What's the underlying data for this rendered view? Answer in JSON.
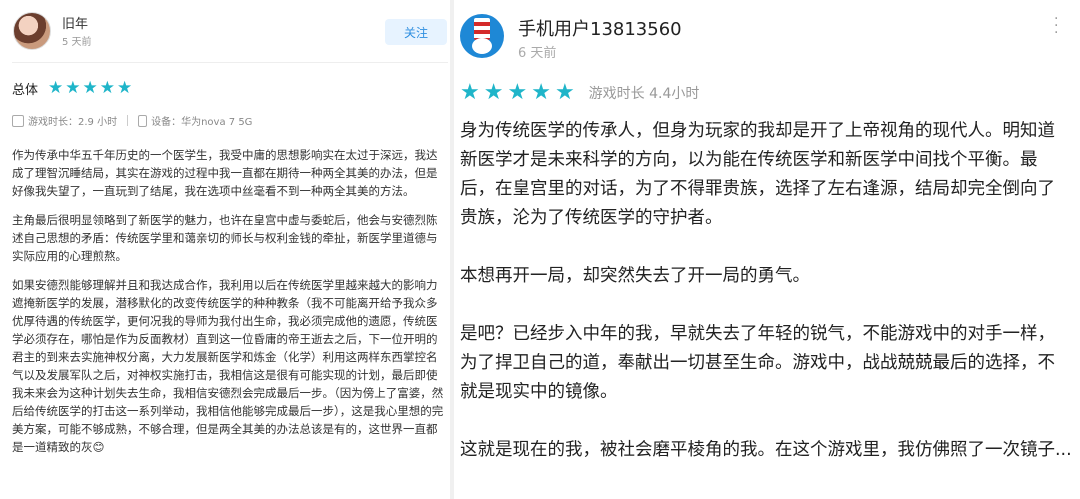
{
  "left": {
    "user_name": "旧年",
    "time": "5 天前",
    "follow_label": "关注",
    "rating_label": "总体",
    "stars": 5,
    "playtime_label": "游戏时长：2.9 小时",
    "device_label": "设备：华为nova 7 5G",
    "paragraphs": [
      "作为传承中华五千年历史的一个医学生，我受中庸的思想影响实在太过于深远，我达成了理智沉睡结局，其实在游戏的过程中我一直都在期待一种两全其美的办法，但是好像我失望了，一直玩到了结尾，我在选项中丝毫看不到一种两全其美的方法。",
      "主角最后很明显领略到了新医学的魅力，也许在皇宫中虚与委蛇后，他会与安德烈陈述自己思想的矛盾：传统医学里和蔼亲切的师长与权利金钱的牵扯，新医学里道德与实际应用的心理煎熬。",
      "如果安德烈能够理解并且和我达成合作，我利用以后在传统医学里越来越大的影响力遮掩新医学的发展，潜移默化的改变传统医学的种种教条（我不可能离开给予我众多优厚待遇的传统医学，更何况我的导师为我付出生命，我必须完成他的遗愿，传统医学必须存在，哪怕是作为反面教材）直到这一位昏庸的帝王逝去之后，下一位开明的君主的到来去实施神权分离，大力发展新医学和炼金（化学）利用这两样东西掌控名气以及发展军队之后，对神权实施打击，我相信这是很有可能实现的计划，最后即使我未来会为这种计划失去生命，我相信安德烈会完成最后一步。（因为傍上了富婆，然后给传统医学的打击这一系列举动，我相信他能够完成最后一步），这是我心里想的完美方案，可能不够成熟，不够合理，但是两全其美的办法总该是有的，这世界一直都是一道精致的灰😊"
    ]
  },
  "right": {
    "user_name": "手机用户13813560",
    "time": "6 天前",
    "stars": 5,
    "playtime_label": "游戏时长 4.4小时",
    "paragraphs": [
      "身为传统医学的传承人，但身为玩家的我却是开了上帝视角的现代人。明知道新医学才是未来科学的方向，以为能在传统医学和新医学中间找个平衡。最后，在皇宫里的对话，为了不得罪贵族，选择了左右逢源，结局却完全倒向了贵族，沦为了传统医学的守护者。",
      "本想再开一局，却突然失去了开一局的勇气。",
      "是吧？已经步入中年的我，早就失去了年轻的锐气，不能游戏中的对手一样，为了捍卫自己的道，奉献出一切甚至生命。游戏中，战战兢兢最后的选择，不就是现实中的镜像。",
      "这就是现在的我，被社会磨平棱角的我。在这个游戏里，我仿佛照了一次镜子..."
    ]
  },
  "colors": {
    "star": "#1fb5c9",
    "follow_bg": "#e7f3ff",
    "follow_text": "#2f8fe0"
  }
}
